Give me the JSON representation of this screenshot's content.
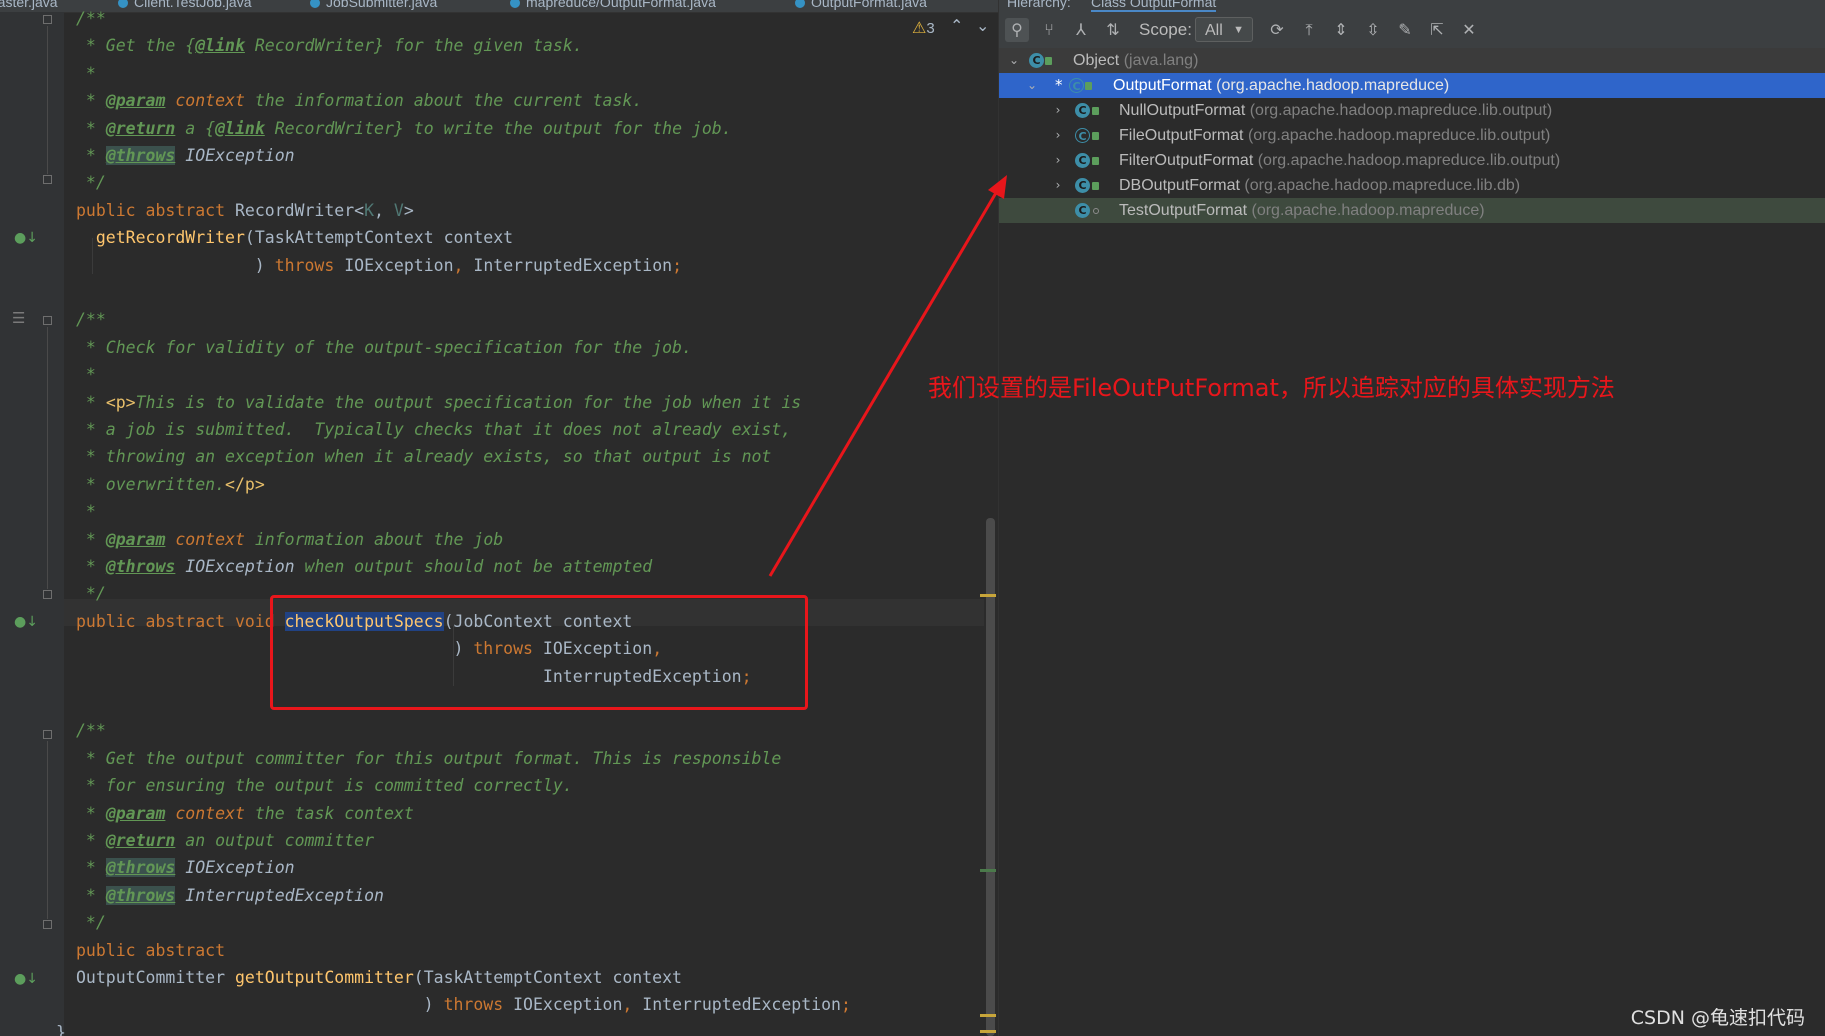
{
  "editor": {
    "tabs": [
      {
        "label": "Master.java"
      },
      {
        "label": "Client.TestJob.java"
      },
      {
        "label": "JobSubmitter.java"
      },
      {
        "label": "mapreduce/OutputFormat.java"
      },
      {
        "label": "OutputFormat.java"
      }
    ],
    "warnings_count": "3",
    "code_lines": [
      "/**",
      " * Get the {@link RecordWriter} for the given task.",
      " *",
      " * @param context the information about the current task.",
      " * @return a {@link RecordWriter} to write the output for the job.",
      " * @throws IOException",
      " */",
      "public abstract RecordWriter<K, V>",
      "  getRecordWriter(TaskAttemptContext context",
      "                  ) throws IOException, InterruptedException;",
      "",
      "/**",
      " * Check for validity of the output-specification for the job.",
      " *",
      " * <p>This is to validate the output specification for the job when it is",
      " * a job is submitted.  Typically checks that it does not already exist,",
      " * throwing an exception when it already exists, so that output is not",
      " * overwritten.</p>",
      " *",
      " * @param context information about the job",
      " * @throws IOException when output should not be attempted",
      " */",
      "public abstract void checkOutputSpecs(JobContext context",
      "                                      ) throws IOException,",
      "                                               InterruptedException;",
      "",
      "/**",
      " * Get the output committer for this output format. This is responsible",
      " * for ensuring the output is committed correctly.",
      " * @param context the task context",
      " * @return an output committer",
      " * @throws IOException",
      " * @throws InterruptedException",
      " */",
      "public abstract",
      "OutputCommitter getOutputCommitter(TaskAttemptContext context",
      "                                   ) throws IOException, InterruptedException;",
      "}"
    ]
  },
  "hierarchy": {
    "tabs": [
      {
        "label": "Hierarchy:"
      },
      {
        "label": "Class OutputFormat"
      }
    ],
    "toolbar": {
      "scope_label": "Scope:",
      "scope_value": "All",
      "buttons": [
        "class-hierarchy-icon",
        "supertypes-icon",
        "subtypes-icon",
        "sort-alpha-icon",
        "refresh-icon",
        "scroll-to-source-icon",
        "expand-all-icon",
        "collapse-all-icon",
        "pin-icon",
        "export-icon",
        "close-icon"
      ]
    },
    "nodes": [
      {
        "name": "Object",
        "pkg": "(java.lang)",
        "level": 0,
        "expanded": true,
        "kind": "class"
      },
      {
        "name": "OutputFormat",
        "pkg": "(org.apache.hadoop.mapreduce)",
        "level": 1,
        "expanded": true,
        "kind": "abstract",
        "selected": true,
        "starred": true
      },
      {
        "name": "NullOutputFormat",
        "pkg": "(org.apache.hadoop.mapreduce.lib.output)",
        "level": 2,
        "expanded": false,
        "kind": "class"
      },
      {
        "name": "FileOutputFormat",
        "pkg": "(org.apache.hadoop.mapreduce.lib.output)",
        "level": 2,
        "expanded": false,
        "kind": "abstract"
      },
      {
        "name": "FilterOutputFormat",
        "pkg": "(org.apache.hadoop.mapreduce.lib.output)",
        "level": 2,
        "expanded": false,
        "kind": "class"
      },
      {
        "name": "DBOutputFormat",
        "pkg": "(org.apache.hadoop.mapreduce.lib.db)",
        "level": 2,
        "expanded": false,
        "kind": "class"
      },
      {
        "name": "TestOutputFormat",
        "pkg": "(org.apache.hadoop.mapreduce)",
        "level": 2,
        "expanded": null,
        "kind": "class",
        "current": true
      }
    ]
  },
  "annotation": {
    "text": "我们设置的是FileOutPutFormat，所以追踪对应的具体实现方法",
    "color": "#e8161b"
  },
  "watermark": "CSDN @龟速扣代码",
  "colors": {
    "background": "#2b2b2b",
    "keyword": "#cc7832",
    "method": "#ffc66d",
    "doc_comment": "#629755",
    "selection": "#2f65ca",
    "highlight_box": "#e8161b"
  }
}
